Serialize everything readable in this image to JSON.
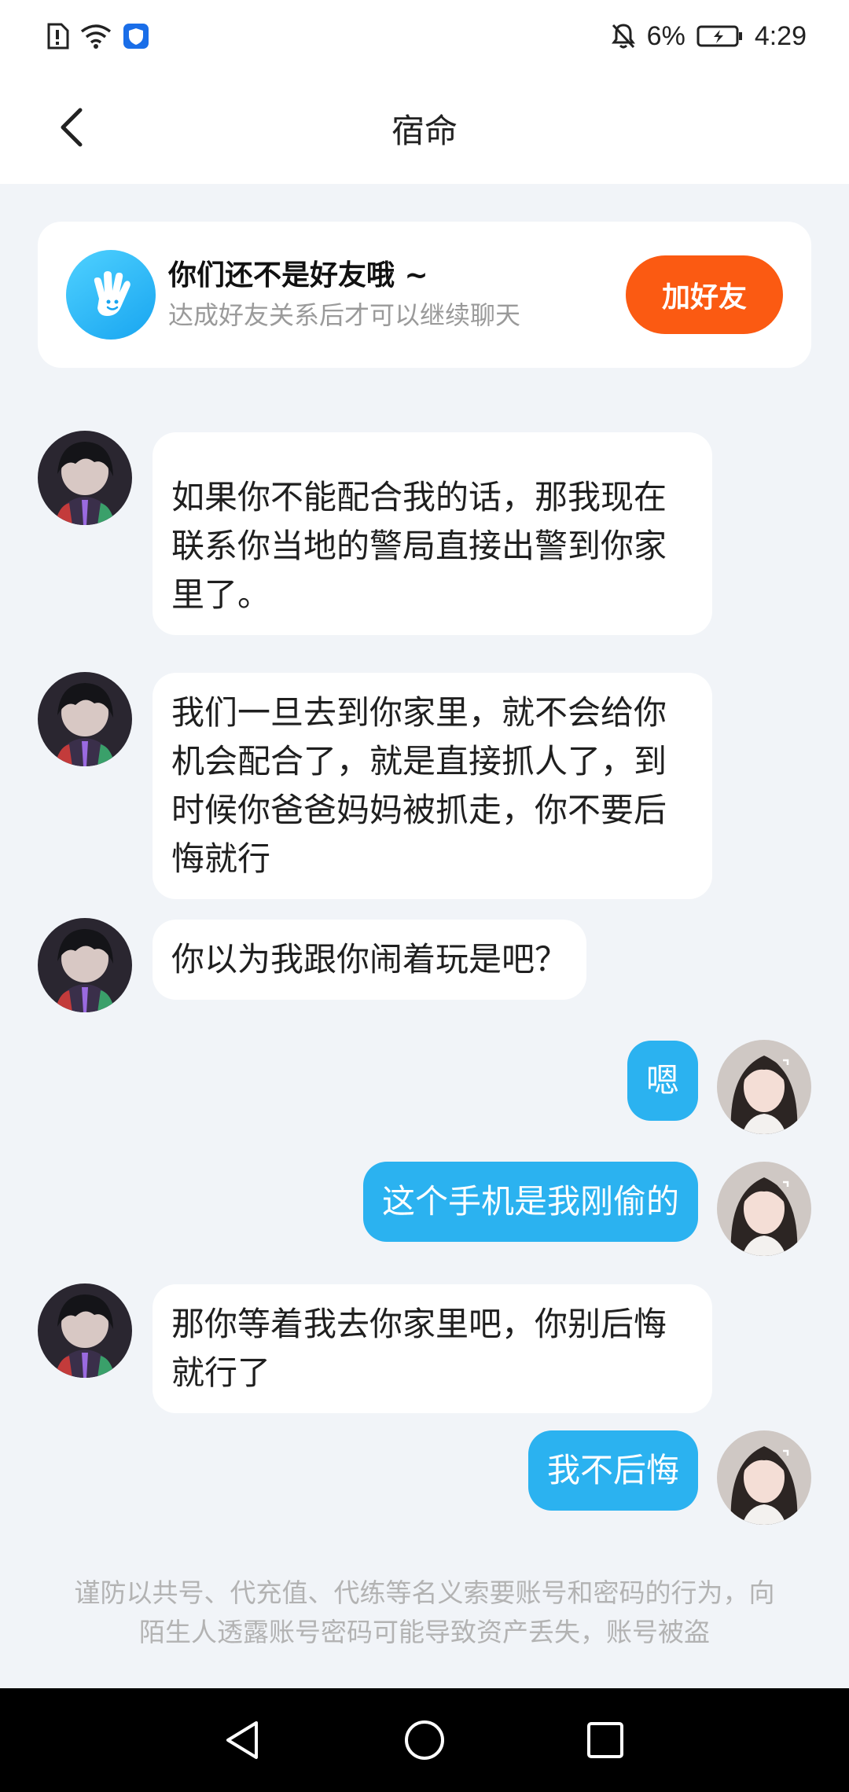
{
  "status_bar": {
    "battery_percent": "6%",
    "time": "4:29",
    "icons": [
      "sim-alert-icon",
      "wifi-icon",
      "shield-app-icon",
      "bell-off-icon",
      "battery-icon"
    ]
  },
  "header": {
    "title": "宿命",
    "back_icon": "chevron-left-icon"
  },
  "friend_banner": {
    "icon": "waving-hand-icon",
    "title": "你们还不是好友哦 ~",
    "subtitle": "达成好友关系后才可以继续聊天",
    "add_button": "加好友"
  },
  "messages": [
    {
      "side": "left",
      "text": "如果你不能配合我的话，那我现在联系你当地的警局直接出警到你家里了。"
    },
    {
      "side": "left",
      "text": "我们一旦去到你家里，就不会给你机会配合了，就是直接抓人了，到时候你爸爸妈妈被抓走，你不要后悔就行"
    },
    {
      "side": "left",
      "text": "你以为我跟你闹着玩是吧？"
    },
    {
      "side": "right",
      "text": "嗯"
    },
    {
      "side": "right",
      "text": "这个手机是我刚偷的"
    },
    {
      "side": "left",
      "text": "那你等着我去你家里吧，你别后悔就行了"
    },
    {
      "side": "right",
      "text": "我不后悔"
    }
  ],
  "warning": "谨防以共号、代充值、代练等名义索要账号和密码的行为，向陌生人透露账号密码可能导致资产丢失，账号被盗",
  "colors": {
    "accent_orange": "#fb5a12",
    "bubble_blue": "#2bb2f0",
    "background": "#f1f4f8"
  },
  "nav_bar": {
    "icons": [
      "back-triangle-icon",
      "home-circle-icon",
      "recents-square-icon"
    ]
  }
}
